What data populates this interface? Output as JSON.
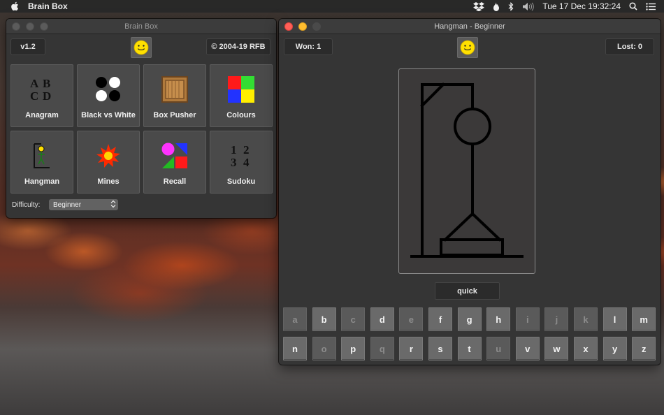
{
  "menubar": {
    "app_name": "Brain Box",
    "clock": "Tue 17 Dec  19:32:24"
  },
  "brainbox": {
    "title": "Brain Box",
    "version": "v1.2",
    "copyright": "© 2004-19 RFB",
    "games": [
      {
        "label": "Anagram",
        "icon": "anagram-icon"
      },
      {
        "label": "Black vs White",
        "icon": "black-white-icon"
      },
      {
        "label": "Box Pusher",
        "icon": "box-icon"
      },
      {
        "label": "Colours",
        "icon": "colours-icon"
      },
      {
        "label": "Hangman",
        "icon": "hangman-icon"
      },
      {
        "label": "Mines",
        "icon": "mine-icon"
      },
      {
        "label": "Recall",
        "icon": "recall-icon"
      },
      {
        "label": "Sudoku",
        "icon": "sudoku-icon"
      }
    ],
    "anagram_icon_text": [
      "A",
      "B",
      "C",
      "D"
    ],
    "sudoku_icon_text": [
      "1",
      "2",
      "3",
      "4"
    ],
    "difficulty_label": "Difficulty:",
    "difficulty_value": "Beginner"
  },
  "hangman": {
    "title": "Hangman - Beginner",
    "won": "Won: 1",
    "lost": "Lost: 0",
    "word": "quick",
    "row1": [
      {
        "l": "a",
        "used": true
      },
      {
        "l": "b",
        "used": false
      },
      {
        "l": "c",
        "used": true
      },
      {
        "l": "d",
        "used": false
      },
      {
        "l": "e",
        "used": true
      },
      {
        "l": "f",
        "used": false
      },
      {
        "l": "g",
        "used": false
      },
      {
        "l": "h",
        "used": false
      },
      {
        "l": "i",
        "used": true
      },
      {
        "l": "j",
        "used": true
      },
      {
        "l": "k",
        "used": true
      },
      {
        "l": "l",
        "used": false
      },
      {
        "l": "m",
        "used": false
      }
    ],
    "row2": [
      {
        "l": "n",
        "used": false
      },
      {
        "l": "o",
        "used": true
      },
      {
        "l": "p",
        "used": false
      },
      {
        "l": "q",
        "used": true
      },
      {
        "l": "r",
        "used": false
      },
      {
        "l": "s",
        "used": false
      },
      {
        "l": "t",
        "used": false
      },
      {
        "l": "u",
        "used": true
      },
      {
        "l": "v",
        "used": false
      },
      {
        "l": "w",
        "used": false
      },
      {
        "l": "x",
        "used": false
      },
      {
        "l": "y",
        "used": false
      },
      {
        "l": "z",
        "used": false
      }
    ]
  },
  "colors": {
    "window_bg": "#353535",
    "tile_bg": "#4a4a4a",
    "key_bg": "#6a6a6a",
    "key_used_bg": "#5a5a5a",
    "smiley": "#ffe000"
  }
}
